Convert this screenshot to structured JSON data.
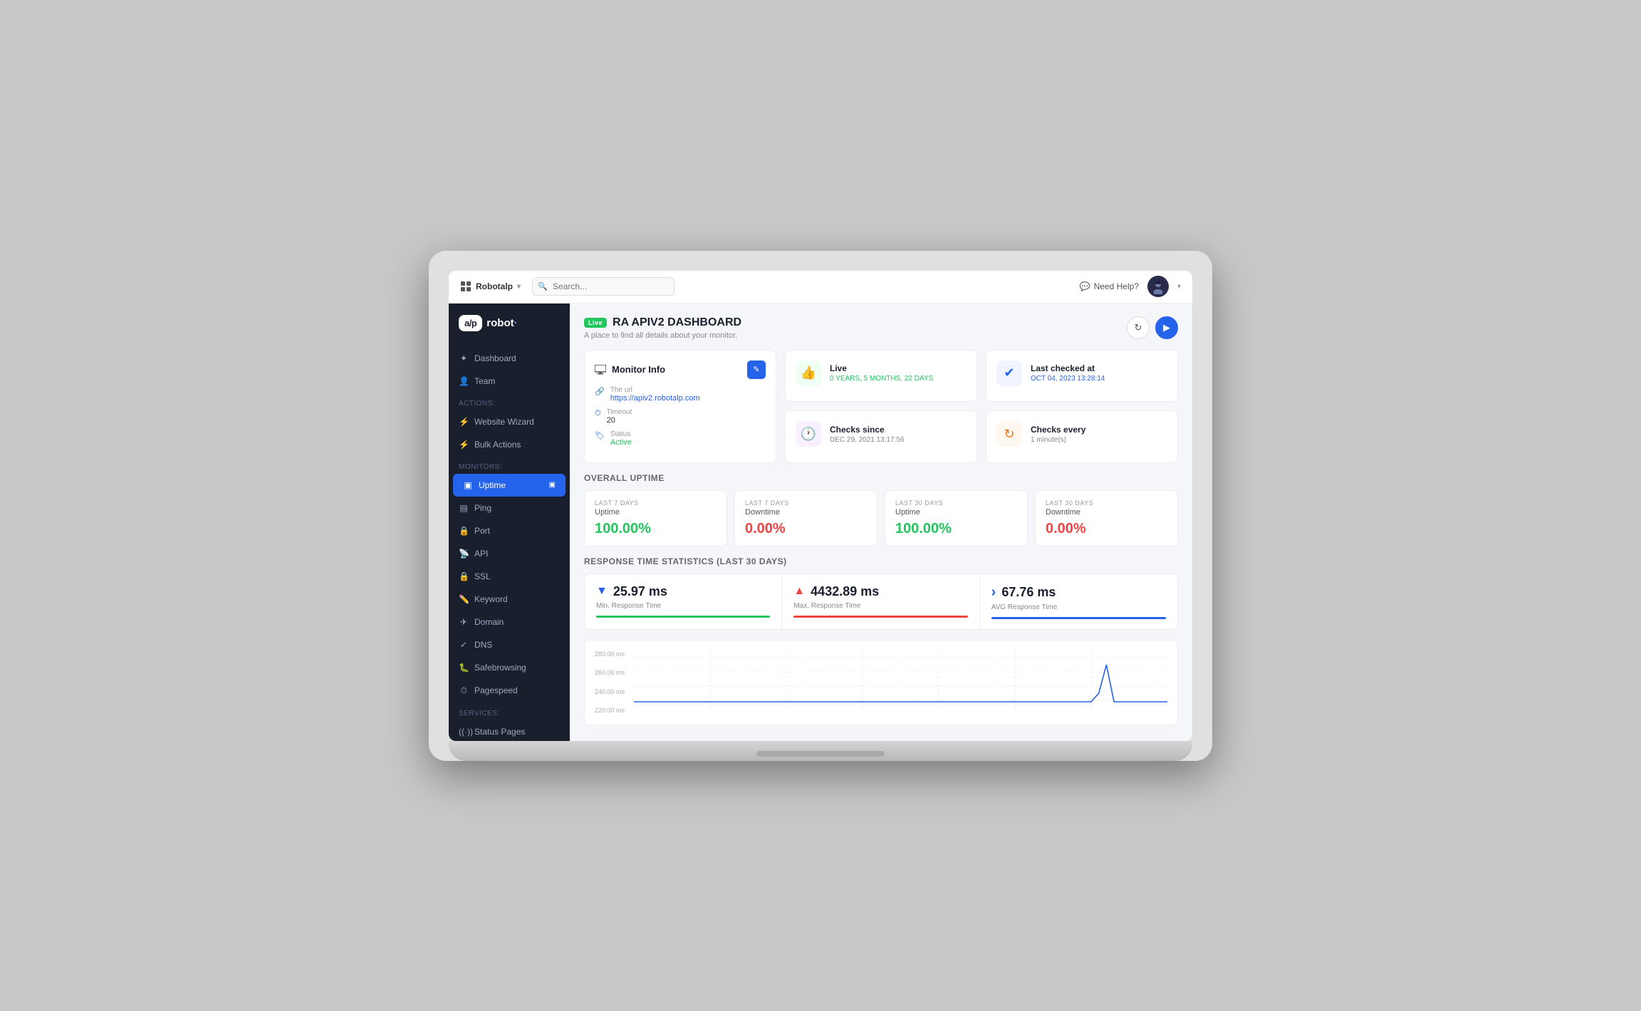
{
  "app": {
    "brand": {
      "logo_text": "a/p",
      "name": "robot"
    }
  },
  "topbar": {
    "workspace": "Robotalp",
    "search_placeholder": "Search...",
    "need_help": "Need Help?",
    "chevron": "▾"
  },
  "sidebar": {
    "nav_items": [
      {
        "id": "dashboard",
        "label": "Dashboard",
        "icon": "✦",
        "active": false
      },
      {
        "id": "team",
        "label": "Team",
        "icon": "👤",
        "active": false
      }
    ],
    "actions_label": "Actions:",
    "actions": [
      {
        "id": "website-wizard",
        "label": "Website Wizard",
        "icon": "⚡"
      },
      {
        "id": "bulk-actions",
        "label": "Bulk Actions",
        "icon": "⚡"
      }
    ],
    "monitors_label": "Monitors:",
    "monitors": [
      {
        "id": "uptime",
        "label": "Uptime",
        "icon": "▣",
        "active": true
      },
      {
        "id": "ping",
        "label": "Ping",
        "icon": "▤"
      },
      {
        "id": "port",
        "label": "Port",
        "icon": "🔒"
      },
      {
        "id": "api",
        "label": "API",
        "icon": "📡"
      },
      {
        "id": "ssl",
        "label": "SSL",
        "icon": "🔒"
      },
      {
        "id": "keyword",
        "label": "Keyword",
        "icon": "✏️"
      },
      {
        "id": "domain",
        "label": "Domain",
        "icon": "✈"
      },
      {
        "id": "dns",
        "label": "DNS",
        "icon": "✓"
      },
      {
        "id": "safebrowsing",
        "label": "Safebrowsing",
        "icon": "🐛"
      },
      {
        "id": "pagespeed",
        "label": "Pagespeed",
        "icon": "⏱"
      }
    ],
    "services_label": "Services:",
    "services": [
      {
        "id": "status-pages",
        "label": "Status Pages",
        "icon": "((·))"
      }
    ]
  },
  "dashboard": {
    "live_badge": "Live",
    "title": "RA APIV2 DASHBOARD",
    "subtitle": "A place to find all details about your monitor.",
    "refresh_label": "↻",
    "play_label": "▶",
    "monitor_info": {
      "title": "Monitor Info",
      "edit_icon": "✎",
      "url_label": "The url",
      "url_value": "https://apiv2.robotalp.com",
      "timeout_label": "Timeout",
      "timeout_value": "20",
      "status_label": "Status",
      "status_value": "Active"
    },
    "live_status": {
      "title": "Live",
      "subtitle": "0 YEARS, 5 MONTHS, 22 DAYS"
    },
    "last_checked": {
      "title": "Last checked at",
      "subtitle": "OCT 04, 2023 13:28:14"
    },
    "checks_since": {
      "title": "Checks since",
      "subtitle": "DEC 29, 2021 13:17:56"
    },
    "checks_every": {
      "title": "Checks every",
      "subtitle": "1 minute(s)"
    },
    "overall_uptime_title": "OVERALL UPTIME",
    "uptime_cards": [
      {
        "period": "LAST 7 DAYS",
        "type": "Uptime",
        "value": "100.00%",
        "color": "green"
      },
      {
        "period": "LAST 7 DAYS",
        "type": "Downtime",
        "value": "0.00%",
        "color": "red"
      },
      {
        "period": "LAST 30 DAYS",
        "type": "Uptime",
        "value": "100.00%",
        "color": "green"
      },
      {
        "period": "LAST 30 DAYS",
        "type": "Downtime",
        "value": "0.00%",
        "color": "red"
      }
    ],
    "response_stats_title": "RESPONSE TIME STATISTICS (LAST 30 DAYS)",
    "response_stats": [
      {
        "arrow": "▼",
        "arrow_color": "down",
        "ms": "25.97 ms",
        "label": "Min. Response Time",
        "bar": "green"
      },
      {
        "arrow": "▲",
        "arrow_color": "up",
        "ms": "4432.89 ms",
        "label": "Max. Response Time",
        "bar": "red"
      },
      {
        "arrow": "›",
        "arrow_color": "right",
        "ms": "67.76 ms",
        "label": "AVG Response Time",
        "bar": "blue"
      }
    ],
    "chart_y_labels": [
      "280.00 ms",
      "260.00 ms",
      "240.00 ms",
      "220.00 ms"
    ]
  }
}
